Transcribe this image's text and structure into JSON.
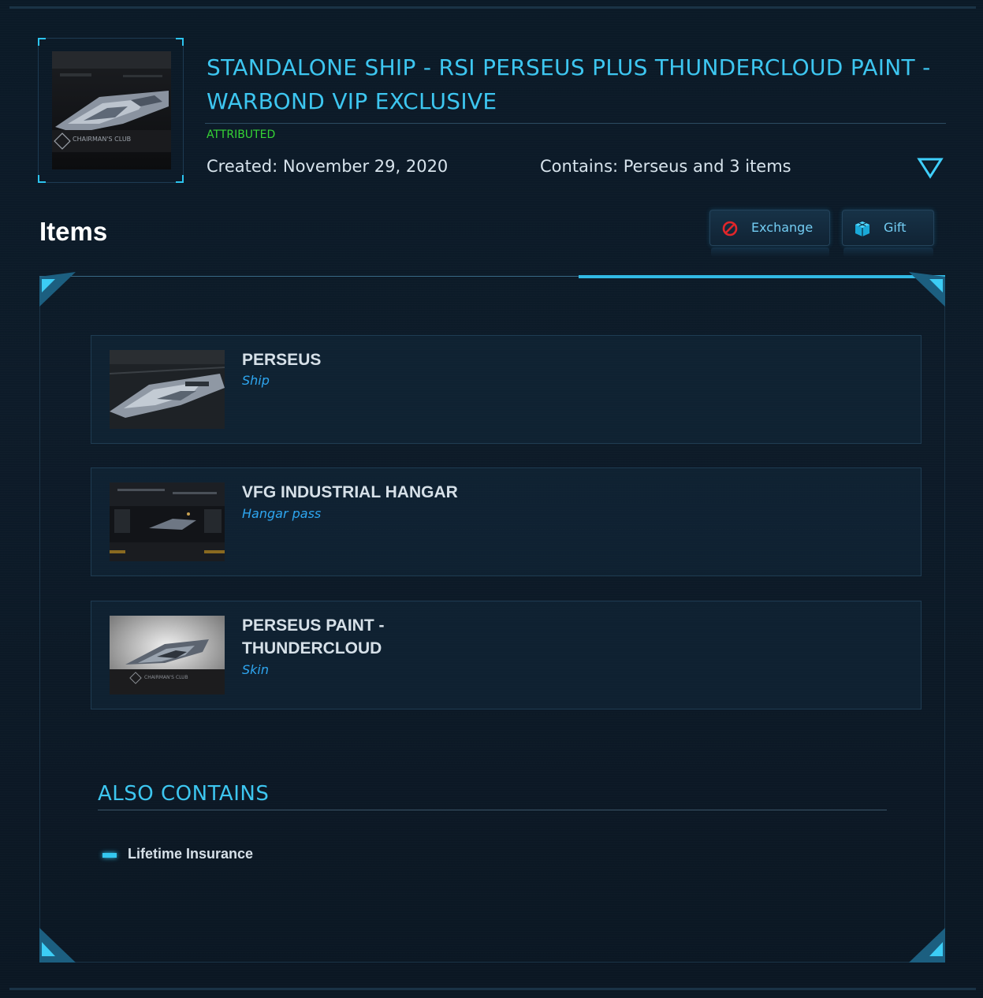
{
  "pledge": {
    "title": "STANDALONE SHIP - RSI PERSEUS PLUS THUNDERCLOUD PAINT - WARBOND VIP EXCLUSIVE",
    "status": "ATTRIBUTED",
    "created": "Created: November 29, 2020",
    "contains": "Contains: Perseus and 3 items",
    "thumbnail_caption": "CHAIRMAN'S CLUB"
  },
  "items_section": {
    "heading": "Items",
    "exchange_label": "Exchange",
    "gift_label": "Gift"
  },
  "items": [
    {
      "name": "PERSEUS",
      "type": "Ship"
    },
    {
      "name": "VFG INDUSTRIAL HANGAR",
      "type": "Hangar pass"
    },
    {
      "name_line1": "PERSEUS PAINT -",
      "name_line2": "THUNDERCLOUD",
      "type": "Skin",
      "caption": "CHAIRMAN'S CLUB"
    }
  ],
  "also_contains": {
    "heading": "ALSO CONTAINS",
    "entries": [
      "Lifetime Insurance"
    ]
  },
  "colors": {
    "accent": "#3dc6f0",
    "status_green": "#35d335",
    "item_type_blue": "#2ea6f0",
    "background": "#0b1a27"
  }
}
